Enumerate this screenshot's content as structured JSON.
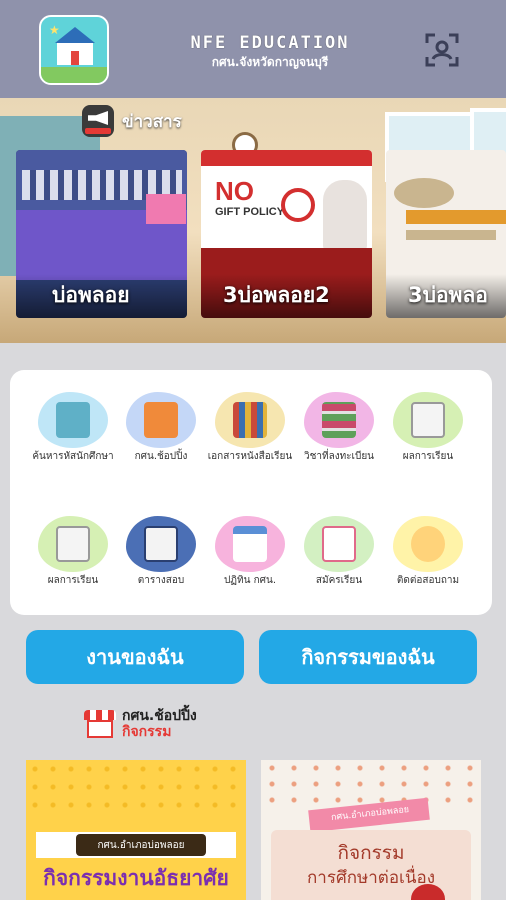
{
  "header": {
    "title": "NFE EDUCATION",
    "subtitle": "กศน.จังหวัดกาญจนบุรี"
  },
  "news": {
    "title": "ข่าวสาร",
    "cards": [
      {
        "caption": "บ่อพลอย"
      },
      {
        "caption": "3บ่อพลอย2"
      },
      {
        "caption": "3บ่อพลอ"
      }
    ]
  },
  "menu": {
    "items": [
      {
        "label": "ค้นหารหัสนักศึกษา",
        "icon": "search-student-icon",
        "color": "#bfe6f7"
      },
      {
        "label": "กศน.ช้อปปิ้ง",
        "icon": "shop-icon",
        "color": "#c4d7f7"
      },
      {
        "label": "เอกสารหนังสือเรียน",
        "icon": "books-icon",
        "color": "#f6e6b0"
      },
      {
        "label": "วิชาที่ลงทะเบียน",
        "icon": "book-stack-icon",
        "color": "#f2b6e6"
      },
      {
        "label": "ผลการเรียน",
        "icon": "documents-icon",
        "color": "#d6f0b4"
      },
      {
        "label": "ผลการเรียน",
        "icon": "documents-icon",
        "color": "#d6f0b4"
      },
      {
        "label": "ตารางสอบ",
        "icon": "schedule-icon",
        "color": "#4b6fb5"
      },
      {
        "label": "ปฏิทิน กศน.",
        "icon": "calendar-icon",
        "color": "#f7b3dd"
      },
      {
        "label": "สมัครเรียน",
        "icon": "register-icon",
        "color": "#d3f0c2"
      },
      {
        "label": "ติดต่อสอบถาม",
        "icon": "contact-icon",
        "color": "#fff3a8"
      }
    ]
  },
  "buttons": {
    "my_work": "งานของฉัน",
    "my_activities": "กิจกรรมของฉัน"
  },
  "shop": {
    "title": "กศน.ช้อปปิ้ง",
    "subtitle": "กิจกรรม",
    "cards": [
      {
        "small": "กศน.อำเภอบ่อพลอย",
        "big": "กิจกรรมงานอัธยาศัย"
      },
      {
        "small": "กศน.อำเภอบ่อพลอย",
        "line1": "กิจกรรม",
        "line2": "การศึกษาต่อเนื่อง"
      }
    ]
  },
  "colors": {
    "accent": "#23a8e6",
    "header_bg": "#8f92ab"
  }
}
